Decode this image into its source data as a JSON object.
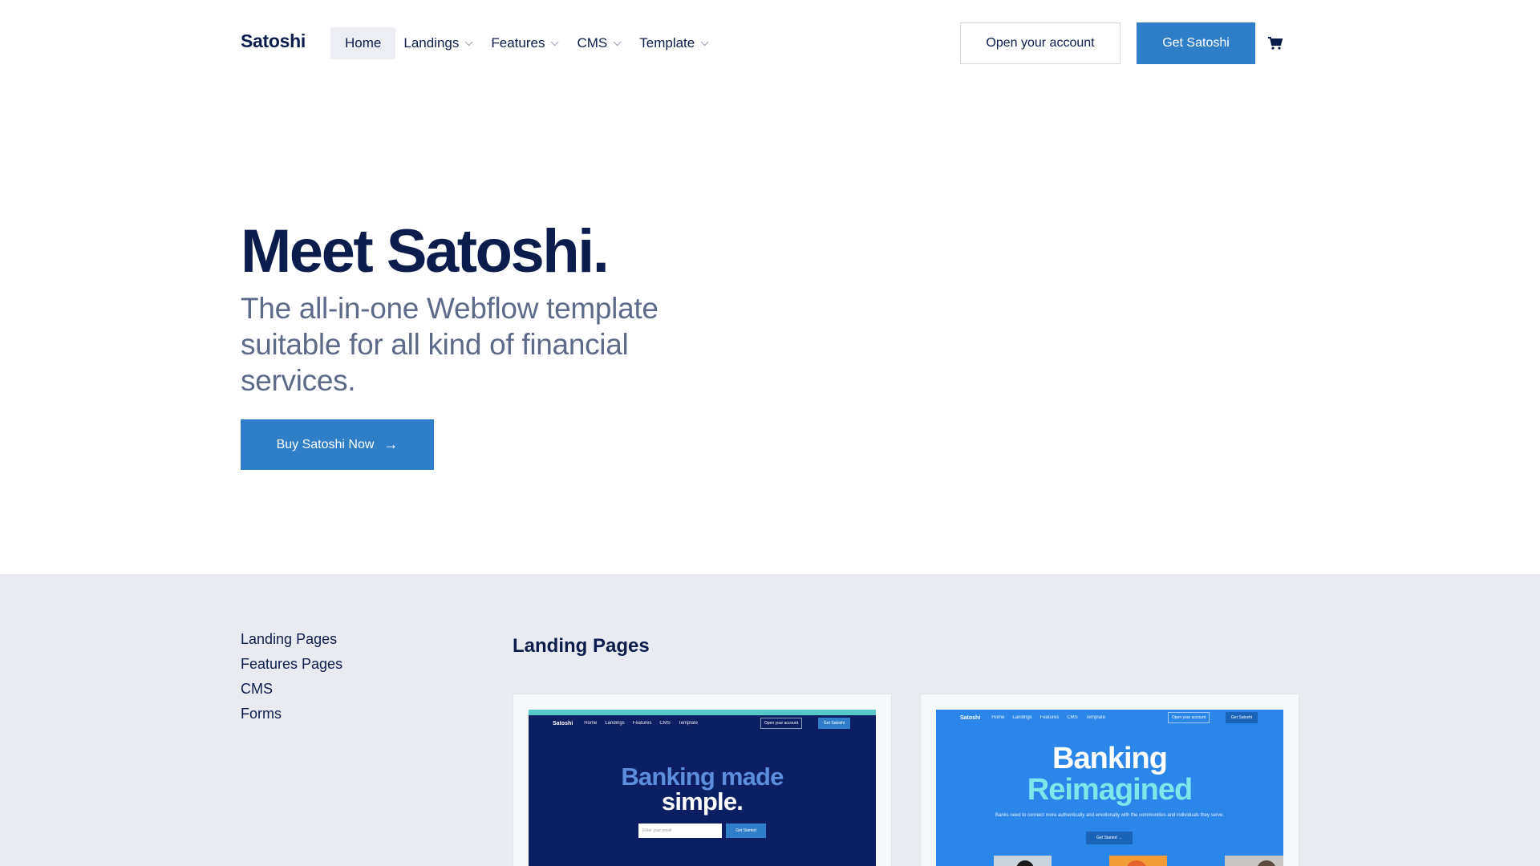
{
  "header": {
    "logo": "Satoshi",
    "nav": [
      {
        "label": "Home",
        "active": true
      },
      {
        "label": "Landings",
        "dropdown": true
      },
      {
        "label": "Features",
        "dropdown": true
      },
      {
        "label": "CMS",
        "dropdown": true
      },
      {
        "label": "Template",
        "dropdown": true
      }
    ],
    "open_account_label": "Open your account",
    "get_satoshi_label": "Get Satoshi",
    "cart_icon": "cart-icon"
  },
  "hero": {
    "title": "Meet Satoshi.",
    "subtitle": "The all-in-one Webflow template suitable for all kind of financial services.",
    "cta_label": "Buy Satoshi Now",
    "cta_icon": "arrow-right-icon"
  },
  "sidebar": {
    "links": [
      "Landing Pages",
      "Features Pages",
      "CMS",
      "Forms"
    ]
  },
  "section": {
    "title": "Landing Pages"
  },
  "cards": [
    {
      "mini_logo": "Satoshi",
      "mini_nav": [
        "Home",
        "Landings",
        "Features",
        "CMS",
        "Template"
      ],
      "mini_outline": "Open your account",
      "mini_btn": "Get Satoshi",
      "heading_1": "Banking made",
      "heading_2": "simple.",
      "input_placeholder": "Enter your email",
      "button": "Get Started"
    },
    {
      "mini_logo": "Satoshi",
      "mini_nav": [
        "Home",
        "Landings",
        "Features",
        "CMS",
        "Template"
      ],
      "mini_outline": "Open your account",
      "mini_btn": "Get Satoshi",
      "heading_1": "Banking",
      "heading_2": "Reimagined",
      "text": "Banks need to connect more authentically and emotionally with the communities and individuals they serve.",
      "button": "Get Started →"
    }
  ],
  "colors": {
    "primary": "#2f7ec7",
    "navy": "#0b1c4d",
    "muted": "#5d6a88",
    "section_bg": "#eaebf0"
  }
}
